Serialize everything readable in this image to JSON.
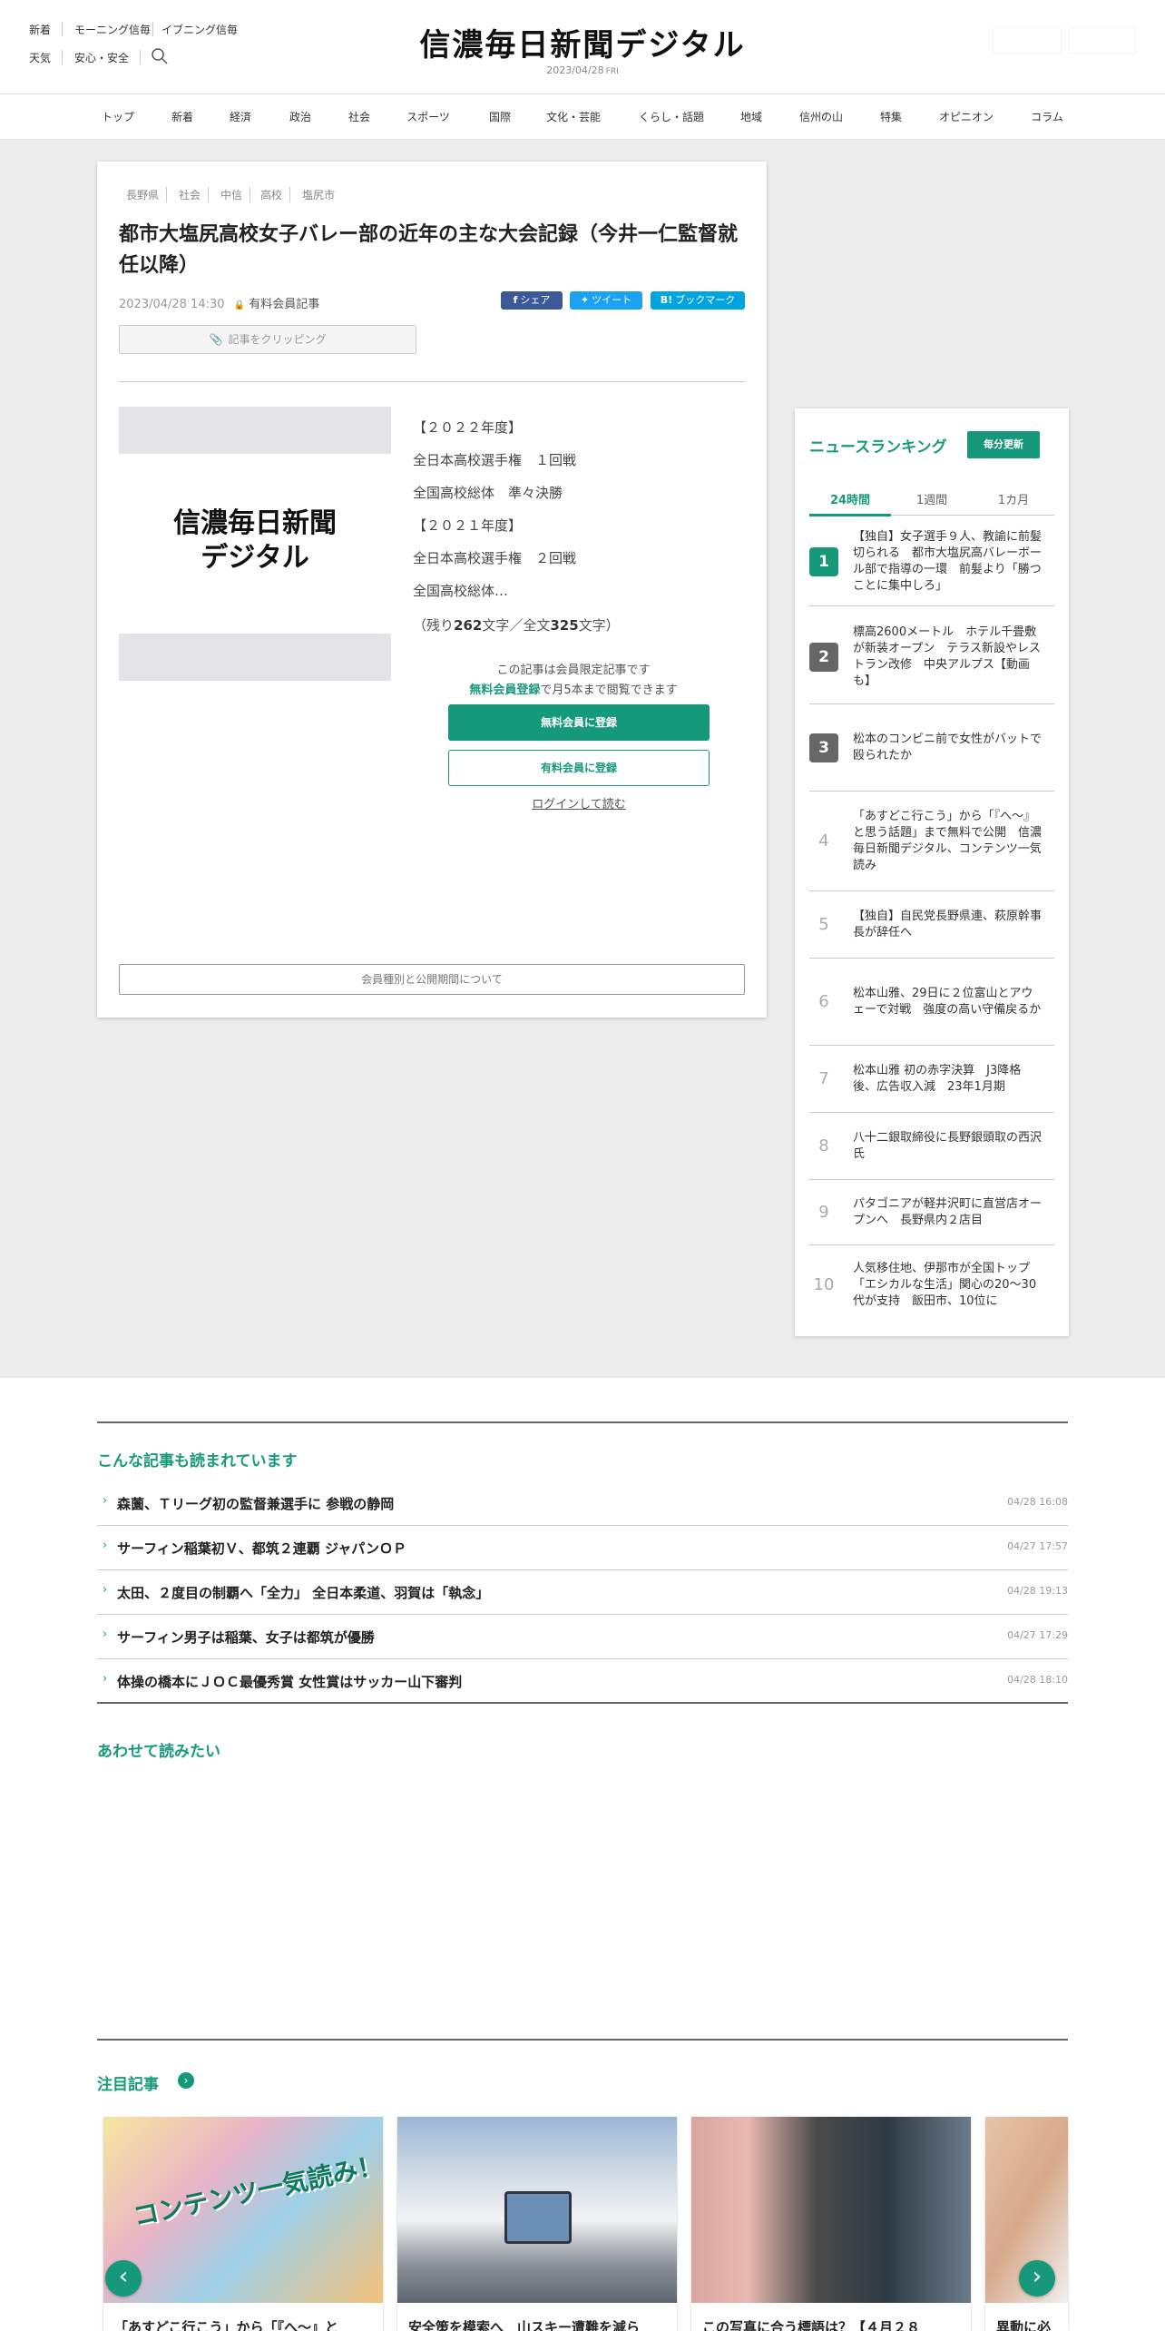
{
  "header": {
    "top_links": [
      "新着",
      "モーニング信毎",
      "イブニング信毎"
    ],
    "bottom_links": [
      "天気",
      "安心・安全"
    ],
    "search_icon": "search-icon",
    "logo": "信濃毎日新聞デジタル",
    "date": "2023/04/28",
    "weekday": "FRI"
  },
  "nav": [
    "トップ",
    "新着",
    "経済",
    "政治",
    "社会",
    "スポーツ",
    "国際",
    "文化・芸能",
    "くらし・話題",
    "地域",
    "信州の山",
    "特集",
    "オピニオン",
    "コラム"
  ],
  "article": {
    "tags": [
      "長野県",
      "社会",
      "中信",
      "高校",
      "塩尻市"
    ],
    "title": "都市大塩尻高校女子バレー部の近年の主な大会記録（今井一仁監督就任以降）",
    "datetime": "2023/04/28 14:30",
    "member_label": "有料会員記事",
    "share_fb": "シェア",
    "share_tw": "ツイート",
    "share_bm": "ブックマーク",
    "clip_label": "記事をクリッピング",
    "image_logo_line1": "信濃毎日新聞",
    "image_logo_line2": "デジタル",
    "body_lines": [
      "【２０２２年度】",
      "全日本高校選手権　１回戦",
      "全国高校総体　準々決勝",
      "【２０２１年度】",
      "全日本高校選手権　２回戦",
      "全国高校総体…"
    ],
    "remain_prefix": "（残り",
    "remain_count": "262",
    "remain_mid": "文字／全文",
    "total_count": "325",
    "remain_suffix": "文字）",
    "paywall_note": "この記事は会員限定記事です",
    "paywall_link": "無料会員登録",
    "paywall_note2": "で月5本まで閲覧できます",
    "free_button": "無料会員に登録",
    "paid_button": "有料会員に登録",
    "login_link": "ログインして読む",
    "membership_button": "会員種別と公開期間について"
  },
  "ranking": {
    "title": "ニュースランキング",
    "update_label": "毎分更新",
    "tabs": [
      "24時間",
      "1週間",
      "1カ月"
    ],
    "active_tab": "24時間",
    "items": [
      {
        "rank": "1",
        "text": "【独自】女子選手９人、教諭に前髪切られる　都市大塩尻高バレーボール部で指導の一環　前髪より「勝つことに集中しろ」"
      },
      {
        "rank": "2",
        "text": "標高2600メートル　ホテル千畳敷が新装オープン　テラス新設やレストラン改修　中央アルプス【動画も】"
      },
      {
        "rank": "3",
        "text": "松本のコンビニ前で女性がバットで殴られたか"
      },
      {
        "rank": "4",
        "text": "「あすどこ行こう」から「『へ～』と思う話題」まで無料で公開　信濃毎日新聞デジタル、コンテンツ一気読み"
      },
      {
        "rank": "5",
        "text": "【独自】自民党長野県連、萩原幹事長が辞任へ"
      },
      {
        "rank": "6",
        "text": "松本山雅、29日に２位富山とアウェーで対戦　強度の高い守備戻るか"
      },
      {
        "rank": "7",
        "text": "松本山雅 初の赤字決算　J3降格後、広告収入減　23年1月期"
      },
      {
        "rank": "8",
        "text": "八十二銀取締役に長野銀頭取の西沢氏"
      },
      {
        "rank": "9",
        "text": "パタゴニアが軽井沢町に直営店オープンへ　長野県内２店目"
      },
      {
        "rank": "10",
        "text": "人気移住地、伊那市が全国トップ　「エシカルな生活」関心の20～30代が支持　飯田市、10位に"
      }
    ]
  },
  "related": {
    "title": "こんな記事も読まれています",
    "items": [
      {
        "title": "森薗、Ｔリーグ初の監督兼選手に 参戦の静岡",
        "date": "04/28 16:08"
      },
      {
        "title": "サーフィン稲葉初Ｖ、都筑２連覇 ジャパンＯＰ",
        "date": "04/27 17:57"
      },
      {
        "title": "太田、２度目の制覇へ「全力」 全日本柔道、羽賀は「執念」",
        "date": "04/28 19:13"
      },
      {
        "title": "サーフィン男子は稲葉、女子は都筑が優勝",
        "date": "04/27 17:29"
      },
      {
        "title": "体操の橋本にＪＯＣ最優秀賞 女性賞はサッカー山下審判",
        "date": "04/28 18:10"
      }
    ]
  },
  "also_read": {
    "title": "あわせて読みたい"
  },
  "featured": {
    "title": "注目記事",
    "cards": [
      {
        "caption": "「あすどこ行こう」から「『へ～』と",
        "image_text": "コンテンツ一気読み！"
      },
      {
        "caption": "安全策を模索へ　山スキー遭難を減ら"
      },
      {
        "caption": "この写真に合う標語は？【４月２８"
      },
      {
        "caption": "異動に必"
      }
    ],
    "prev_label": "‹",
    "next_label": "›"
  }
}
